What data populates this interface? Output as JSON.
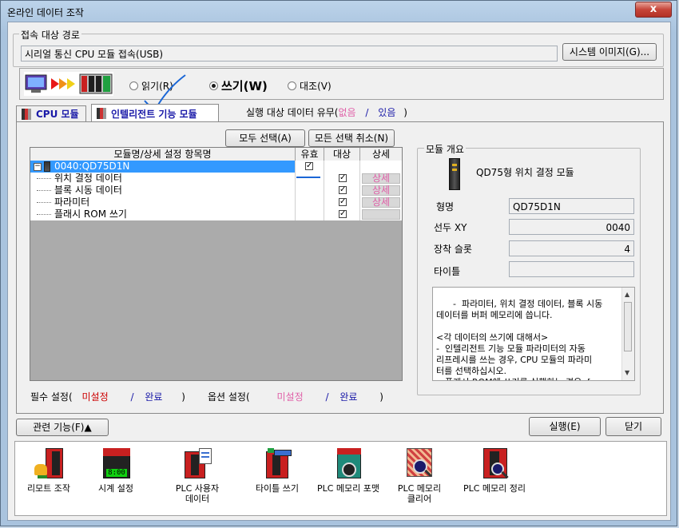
{
  "window": {
    "title": "온라인 데이터 조작",
    "close_label": "x"
  },
  "connection": {
    "group_label": "접속 대상 경로",
    "path_value": "시리얼 통신 CPU 모듈 접속(USB)",
    "system_image_button": "시스템 이미지(G)..."
  },
  "mode": {
    "read_label": "읽기(R)",
    "write_label": "쓰기(W)",
    "verify_label": "대조(V)",
    "selected": "write"
  },
  "tabs": {
    "cpu_tab": "CPU 모듈",
    "intelligent_tab": "인텔리전트 기능 모듈",
    "exec_data_text": "실행 대상 데이터 유무(",
    "exec_none": "없음",
    "exec_slash": "/",
    "exec_exist": "있음",
    "exec_close": ")"
  },
  "buttons": {
    "select_all": "모두 선택(A)",
    "deselect_all": "모든 선택 취소(N)",
    "related_functions": "관련 기능(F)▲",
    "execute": "실행(E)",
    "close": "닫기"
  },
  "grid": {
    "headers": {
      "name": "모듈명/상세 설정 항목명",
      "valid": "유효",
      "target": "대상",
      "detail": "상세"
    },
    "module_row": "0040:QD75D1N",
    "items": [
      {
        "name": "위치 결정 데이터",
        "target": true,
        "detail": "상세"
      },
      {
        "name": "블록 시동 데이터",
        "target": true,
        "detail": "상세"
      },
      {
        "name": "파라미터",
        "target": true,
        "detail": "상세"
      },
      {
        "name": "플래시 ROM 쓰기",
        "target": true,
        "detail": ""
      }
    ]
  },
  "legend": {
    "required": "필수 설정(",
    "required_unset": "미설정",
    "required_slash": "/",
    "required_done": "완료",
    "required_close": ")",
    "optional": "옵션 설정(",
    "optional_unset": "미설정",
    "optional_slash": "/",
    "optional_done": "완료",
    "optional_close": ")"
  },
  "module_overview": {
    "group_label": "모듈 개요",
    "module_title": "QD75형 위치 결정 모듈",
    "model_label": "형명",
    "model_value": "QD75D1N",
    "head_xy_label": "선두 XY",
    "head_xy_value": "0040",
    "slot_label": "장착 슬롯",
    "slot_value": "4",
    "title_label": "타이틀",
    "title_value": "",
    "description": "-  파라미터, 위치 결정 데이터, 블록 시동\n데이터를 버퍼 메모리에 씁니다.\n\n<각 데이터의 쓰기에 대해서>\n-  인텔리전트 기능 모듈 파라미터의 자동\n리프레시를 쓰는 경우, CPU 모듈의 파라미\n터를 선택하십시오.\n-  플래시 ROM에 쓰기를 실행하는 경우, ["
  },
  "tools": [
    {
      "label1": "리모트 조작",
      "label2": "",
      "icon": "remote-operation-icon"
    },
    {
      "label1": "시계 설정",
      "label2": "",
      "icon": "clock-setting-icon",
      "display": "8:00"
    },
    {
      "label1": "PLC 사용자",
      "label2": "데이터",
      "icon": "plc-user-data-icon"
    },
    {
      "label1": "타이틀 쓰기",
      "label2": "",
      "icon": "title-write-icon"
    },
    {
      "label1": "PLC 메모리 포맷",
      "label2": "",
      "icon": "plc-memory-format-icon"
    },
    {
      "label1": "PLC 메모리",
      "label2": "클리어",
      "icon": "plc-memory-clear-icon"
    },
    {
      "label1": "PLC 메모리 정리",
      "label2": "",
      "icon": "plc-memory-arrange-icon"
    }
  ],
  "colors": {
    "accent_blue": "#1a1aa8",
    "unset_pink": "#e060a8",
    "required_red": "#cc0000",
    "selection_blue": "#3399ff"
  }
}
